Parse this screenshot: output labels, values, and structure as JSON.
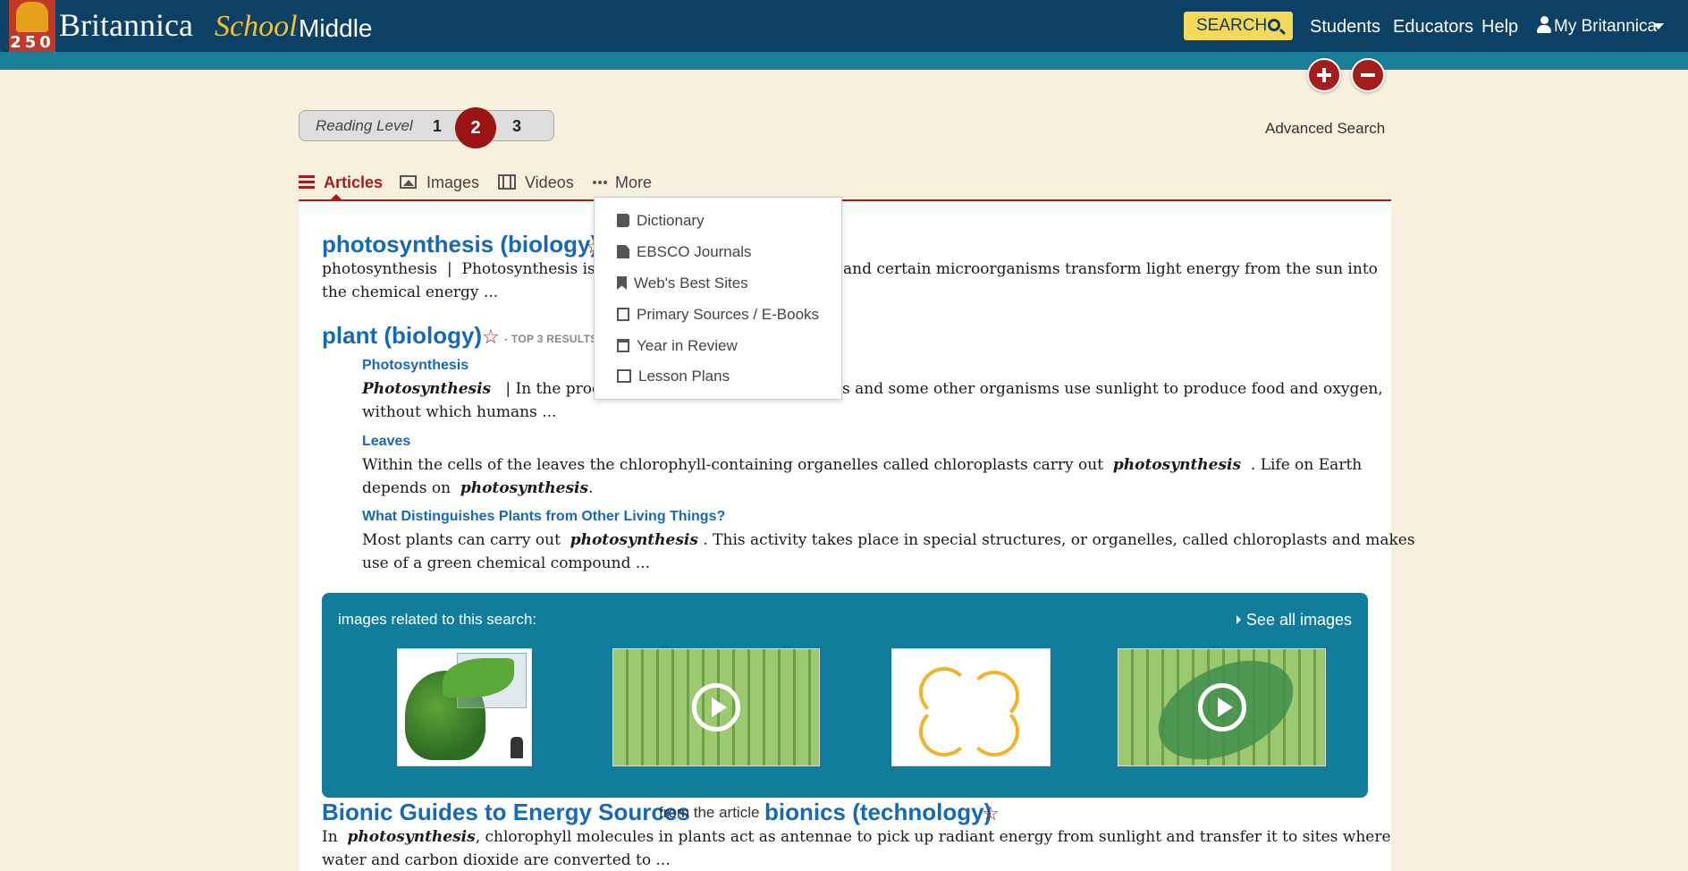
{
  "header": {
    "logo_number": "250",
    "brand": "Britannica",
    "brand_school": "School",
    "level": "Middle",
    "search_label": "SEARCH",
    "nav": [
      "Students",
      "Educators",
      "Help",
      "My Britannica"
    ]
  },
  "reading_level": {
    "label": "Reading Level",
    "levels": [
      "1",
      "2",
      "3"
    ],
    "selected": "2"
  },
  "advanced_search": "Advanced Search",
  "tabs": [
    {
      "label": "Articles",
      "active": true,
      "icon": "list-icon"
    },
    {
      "label": "Images",
      "active": false,
      "icon": "image-icon"
    },
    {
      "label": "Videos",
      "active": false,
      "icon": "film-icon"
    },
    {
      "label": "More",
      "active": false,
      "icon": "dots-icon"
    }
  ],
  "more_menu": [
    {
      "label": "Dictionary",
      "icon": "book-icon"
    },
    {
      "label": "EBSCO Journals",
      "icon": "document-icon"
    },
    {
      "label": "Web's Best Sites",
      "icon": "bookmark-icon"
    },
    {
      "label": "Primary Sources / E-Books",
      "icon": "edit-icon"
    },
    {
      "label": "Year in Review",
      "icon": "calendar-icon"
    },
    {
      "label": "Lesson Plans",
      "icon": "lesson-plans-icon"
    }
  ],
  "results": {
    "r1": {
      "title": "photosynthesis (biology)",
      "prefix": "photosynthesis",
      "sep": "|",
      "snippet_a": "Photosynthesis is",
      "snippet_b": "and certain microorganisms transform light energy from the sun into",
      "snippet_c": "the chemical energy ..."
    },
    "r2": {
      "title": "plant (biology)",
      "top3": "- TOP 3 RESULTS.",
      "sub1": {
        "title": "Photosynthesis",
        "em": "Photosynthesis",
        "text_a": "| In the proces",
        "text_b": "s and some other organisms use sunlight to produce food and oxygen,",
        "text_c": "without which humans ..."
      },
      "sub2": {
        "title": "Leaves",
        "text_a": "Within the cells of the leaves the chlorophyll-containing organelles called chloroplasts carry out",
        "em1": "photosynthesis",
        "text_b": ". Life on Earth",
        "text_c": "depends on",
        "em2": "photosynthesis",
        "text_d": "."
      },
      "sub3": {
        "title": "What Distinguishes Plants from Other Living Things?",
        "text_a": "Most plants can carry out",
        "em": "photosynthesis",
        "text_b": ". This activity takes place in special structures, or organelles, called chloroplasts and makes",
        "text_c": "use of a green chemical compound ..."
      }
    },
    "r3": {
      "title": "Bionic Guides to Energy Sources",
      "from": "from the article",
      "article": "bionics (technology)",
      "text_a": "In",
      "em": "photosynthesis",
      "text_b": ", chlorophyll molecules in plants act as antennae to pick up radiant energy from sunlight and transfer it to sites where",
      "text_c": "water and carbon dioxide are converted to ..."
    }
  },
  "images_band": {
    "label": "images related to this search:",
    "see_all": "See all images"
  },
  "colors": {
    "header_bg": "#0c4064",
    "subbar_bg": "#1a7f99",
    "accent_red": "#a51c1c",
    "link_blue": "#1669b6",
    "band_teal": "#117d9a",
    "page_bg": "#f7f0dd"
  }
}
